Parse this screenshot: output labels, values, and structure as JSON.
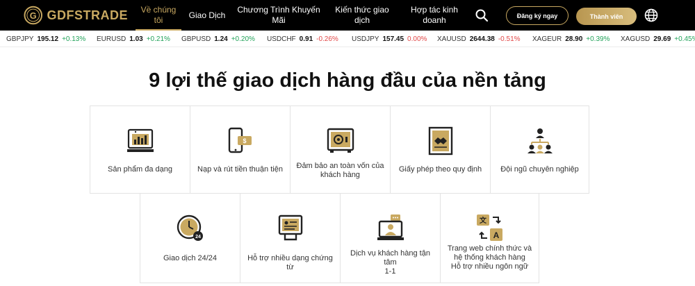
{
  "brand": {
    "name": "GDFSTRADE",
    "logo_letter": "G"
  },
  "nav": {
    "items": [
      {
        "line1": "Về chúng",
        "line2": "tôi",
        "active": true
      },
      {
        "line1": "Giao Dịch",
        "line2": ""
      },
      {
        "line1": "Chương Trình Khuyến",
        "line2": "Mãi"
      },
      {
        "line1": "Kiến thức giao",
        "line2": "dịch"
      },
      {
        "line1": "Hợp tác kinh",
        "line2": "doanh"
      }
    ],
    "register": "Đăng ký ngay",
    "member": "Thành viên"
  },
  "ticker": [
    {
      "sym": "GBPJPY",
      "price": "195.12",
      "chg": "+0.13%",
      "dir": "up"
    },
    {
      "sym": "EURUSD",
      "price": "1.03",
      "chg": "+0.21%",
      "dir": "up"
    },
    {
      "sym": "GBPUSD",
      "price": "1.24",
      "chg": "+0.20%",
      "dir": "up"
    },
    {
      "sym": "USDCHF",
      "price": "0.91",
      "chg": "-0.26%",
      "dir": "down"
    },
    {
      "sym": "USDJPY",
      "price": "157.45",
      "chg": "0.00%",
      "dir": "down"
    },
    {
      "sym": "XAUUSD",
      "price": "2644.38",
      "chg": "-0.51%",
      "dir": "down"
    },
    {
      "sym": "XAGEUR",
      "price": "28.90",
      "chg": "+0.39%",
      "dir": "up"
    },
    {
      "sym": "XAGUSD",
      "price": "29.69",
      "chg": "+0.45%",
      "dir": "up"
    }
  ],
  "section": {
    "title": "9 lợi thế giao dịch hàng đầu của nền tảng",
    "cards": [
      {
        "icon": "product-chart-icon",
        "label1": "Sản phẩm đa dạng",
        "label2": ""
      },
      {
        "icon": "mobile-payment-icon",
        "label1": "Nạp và rút tiền thuận tiện",
        "label2": ""
      },
      {
        "icon": "safe-icon",
        "label1": "Đảm bảo an toàn vốn của",
        "label2": "khách hàng"
      },
      {
        "icon": "license-handshake-icon",
        "label1": "Giấy phép theo quy định",
        "label2": ""
      },
      {
        "icon": "team-icon",
        "label1": "Đội ngũ chuyên nghiệp",
        "label2": ""
      },
      {
        "icon": "clock-24-icon",
        "label1": "Giao dịch 24/24",
        "label2": ""
      },
      {
        "icon": "documents-icon",
        "label1": "Hỗ trợ nhiều dạng chứng từ",
        "label2": ""
      },
      {
        "icon": "customer-service-icon",
        "label1": "Dịch vụ khách hàng tận tâm",
        "label2": "1-1"
      },
      {
        "icon": "translate-icon",
        "label1": "Trang web chính thức và",
        "label2": "hệ thống khách hàng",
        "label3": "Hỗ trợ nhiều ngôn ngữ"
      }
    ]
  },
  "colors": {
    "gold": "#c9a961",
    "black": "#000000",
    "up": "#22a35a",
    "down": "#e24848"
  }
}
